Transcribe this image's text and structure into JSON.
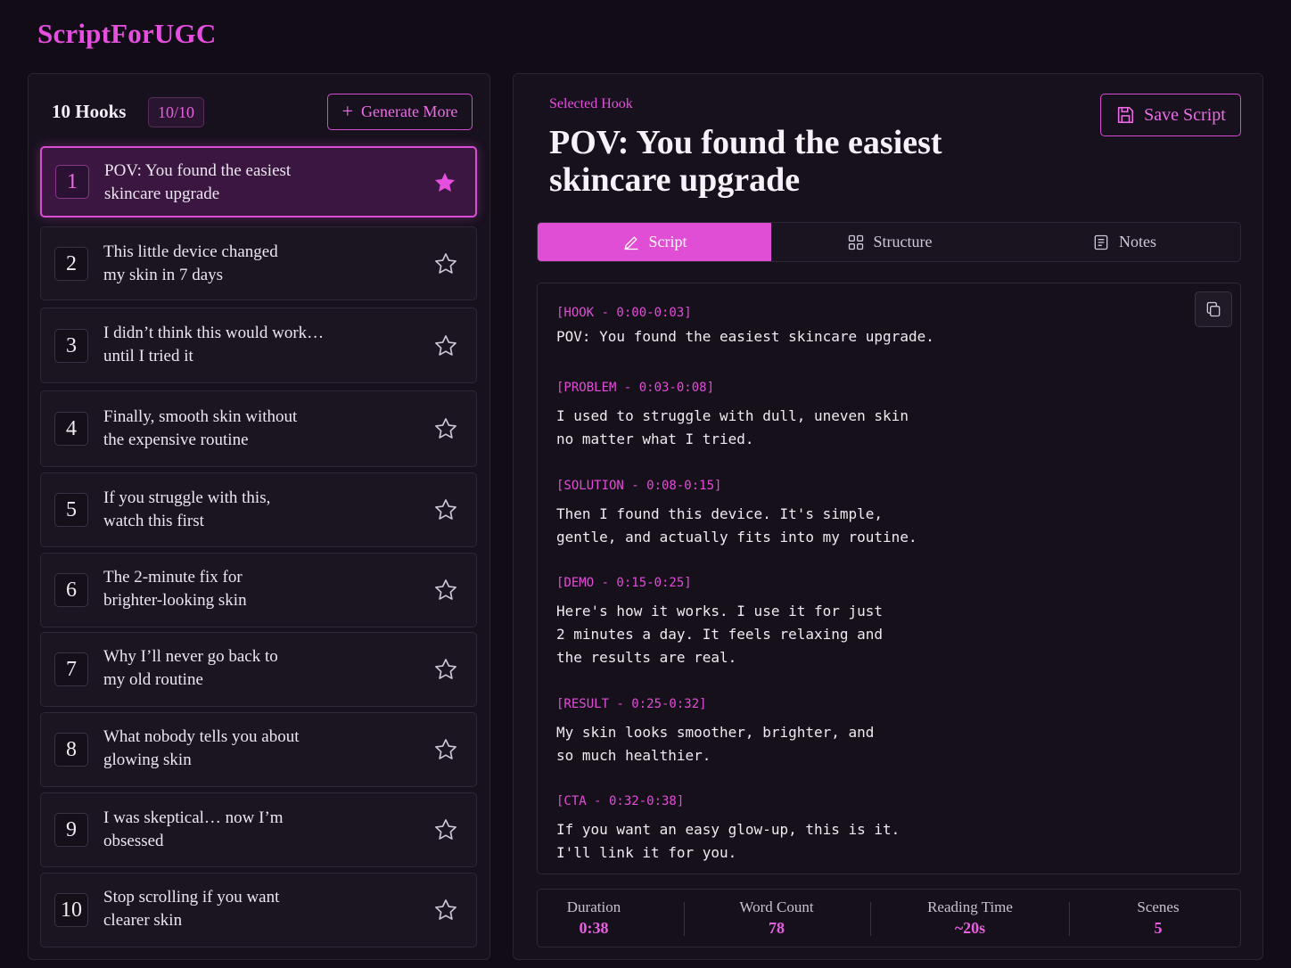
{
  "app": {
    "title": "ScriptForUGC",
    "accent": "#e04ed6"
  },
  "hooks_panel": {
    "heading": "10 Hooks",
    "counter": "10/10",
    "generate_label": "Generate More",
    "items": [
      {
        "number": "1",
        "line1": "POV: You found the easiest",
        "line2": "skincare upgrade",
        "starred": true,
        "selected": true
      },
      {
        "number": "2",
        "line1": "This little device changed",
        "line2": "my skin in 7 days",
        "starred": false
      },
      {
        "number": "3",
        "line1": "I didn’t think this would work…",
        "line2": "until I tried it",
        "starred": false
      },
      {
        "number": "4",
        "line1": "Finally, smooth skin without",
        "line2": "the expensive routine",
        "starred": false
      },
      {
        "number": "5",
        "line1": "If you struggle with this,",
        "line2": "watch this first",
        "starred": false
      },
      {
        "number": "6",
        "line1": "The 2-minute fix for",
        "line2": "brighter-looking skin",
        "starred": false
      },
      {
        "number": "7",
        "line1": "Why I’ll never go back to",
        "line2": "my old routine",
        "starred": false
      },
      {
        "number": "8",
        "line1": "What nobody tells you about",
        "line2": "glowing skin",
        "starred": false
      },
      {
        "number": "9",
        "line1": "I was skeptical… now I’m",
        "line2": "obsessed",
        "starred": false
      },
      {
        "number": "10",
        "line1": "Stop scrolling if you want",
        "line2": "clearer skin",
        "starred": false
      }
    ]
  },
  "detail": {
    "label": "Selected Hook",
    "title_line1": "POV: You found the easiest",
    "title_line2": "skincare upgrade",
    "save_label": "Save Script",
    "tabs": [
      {
        "label": "Script",
        "icon": "pencil-icon",
        "active": true
      },
      {
        "label": "Structure",
        "icon": "grid-icon",
        "active": false
      },
      {
        "label": "Notes",
        "icon": "document-icon",
        "active": false
      }
    ],
    "script": [
      {
        "tag": "[HOOK - 0:00-0:03]",
        "body": "POV: You found the easiest skincare upgrade."
      },
      {
        "tag": "[PROBLEM - 0:03-0:08]",
        "body": "I used to struggle with dull, uneven skin\nno matter what I tried."
      },
      {
        "tag": "[SOLUTION - 0:08-0:15]",
        "body": "Then I found this device. It's simple,\ngentle, and actually fits into my routine."
      },
      {
        "tag": "[DEMO - 0:15-0:25]",
        "body": "Here's how it works. I use it for just\n2 minutes a day. It feels relaxing and\nthe results are real."
      },
      {
        "tag": "[RESULT - 0:25-0:32]",
        "body": "My skin looks smoother, brighter, and\nso much healthier."
      },
      {
        "tag": "[CTA - 0:32-0:38]",
        "body": "If you want an easy glow-up, this is it.\nI'll link it for you."
      }
    ],
    "stats": [
      {
        "label": "Duration",
        "value": "0:38"
      },
      {
        "label": "Word Count",
        "value": "78"
      },
      {
        "label": "Reading Time",
        "value": "~20s"
      },
      {
        "label": "Scenes",
        "value": "5"
      }
    ]
  }
}
